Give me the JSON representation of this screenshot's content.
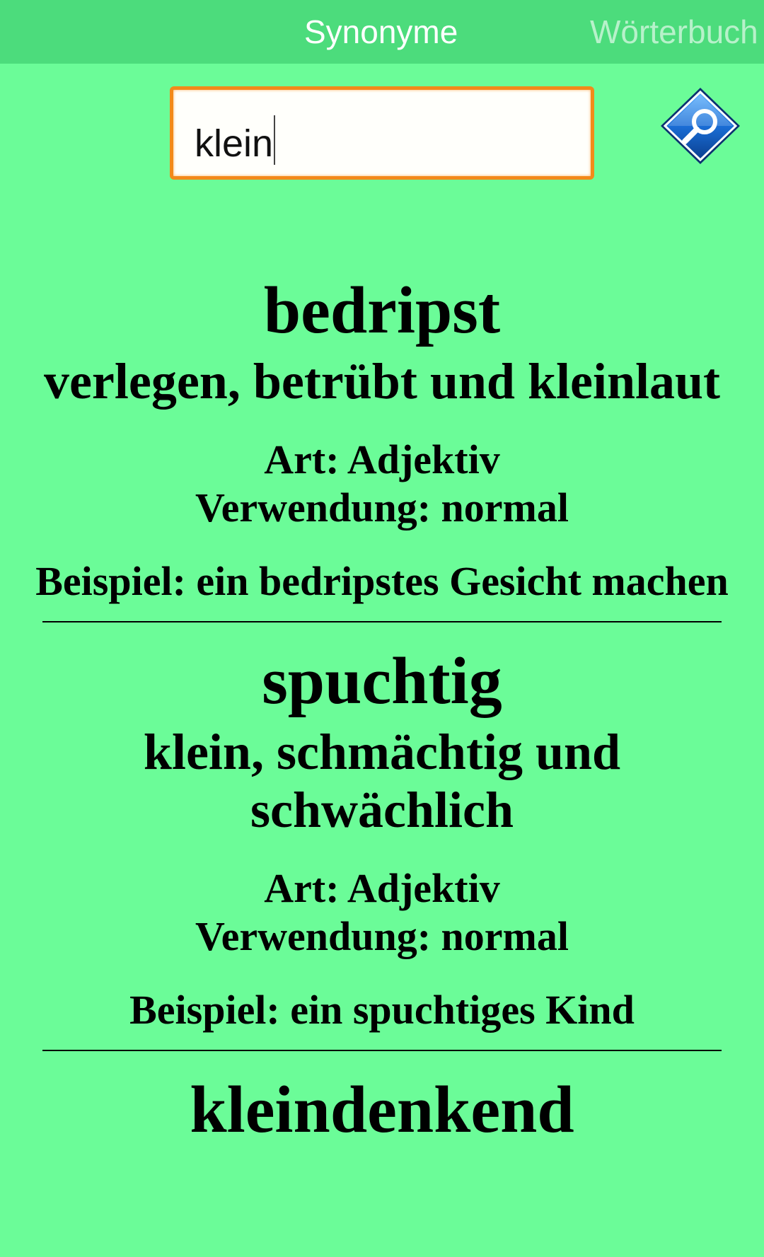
{
  "tabs": [
    {
      "label": "Synonyme",
      "active": true
    },
    {
      "label": "Wörterbuch",
      "active": false
    }
  ],
  "search": {
    "value": "klein"
  },
  "icons": {
    "search_button": "magnifier-icon"
  },
  "colors": {
    "background": "#6bfc98",
    "tab_bar": "#4cdc7c",
    "search_border": "#f28a1a",
    "search_icon": "#1a6ed6"
  },
  "results": [
    {
      "term": "bedripst",
      "definition": "verlegen, betrübt und kleinlaut",
      "type": "Art: Adjektiv",
      "usage": "Verwendung: normal",
      "example": "Beispiel: ein bedripstes Gesicht machen"
    },
    {
      "term": "spuchtig",
      "definition": "klein, schmächtig und schwächlich",
      "type": "Art: Adjektiv",
      "usage": "Verwendung: normal",
      "example": "Beispiel: ein spuchtiges Kind"
    },
    {
      "term": "kleindenkend"
    }
  ]
}
